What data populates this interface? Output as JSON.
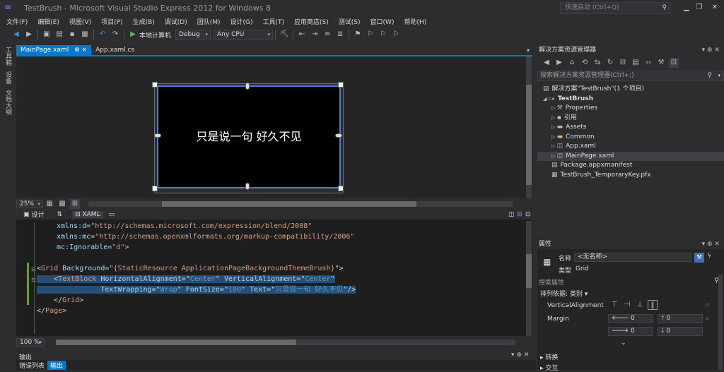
{
  "window": {
    "title": "TestBrush - Microsoft Visual Studio Express 2012 for Windows 8",
    "quick_launch": "快速启动 (Ctrl+Q)"
  },
  "menu": [
    "文件(F)",
    "编辑(E)",
    "视图(V)",
    "项目(P)",
    "生成(B)",
    "调试(D)",
    "团队(M)",
    "设计(G)",
    "工具(T)",
    "应用商店(S)",
    "测试(S)",
    "窗口(W)",
    "帮助(H)"
  ],
  "toolbar": {
    "run_target": "本地计算机",
    "config": "Debug",
    "platform": "Any CPU"
  },
  "left_tabs": [
    "工具箱",
    "设备",
    "文档大纲"
  ],
  "doc_tabs": [
    {
      "label": "MainPage.xaml",
      "pin": "⊕ ×"
    },
    {
      "label": "App.xaml.cs"
    }
  ],
  "designer": {
    "text": "只是说一句 好久不见",
    "zoom": "25%"
  },
  "split": {
    "design_label": "设计",
    "swap": "⇅",
    "xaml_label": "XAML"
  },
  "code_lines": [
    {
      "parts": [
        [
          "c-b",
          "xmlns:d"
        ],
        [
          "c-a",
          "="
        ],
        [
          "c-s",
          "\"http://schemas.microsoft.com/expression/blend/2008\""
        ]
      ]
    },
    {
      "parts": [
        [
          "c-b",
          "xmlns:mc"
        ],
        [
          "c-a",
          "="
        ],
        [
          "c-s",
          "\"http://schemas.openxmlformats.org/markup-compatibility/2006\""
        ]
      ]
    },
    {
      "parts": [
        [
          "c-b",
          "mc:Ignorable"
        ],
        [
          "c-a",
          "="
        ],
        [
          "c-s",
          "\"d\""
        ],
        [
          "c-a",
          ">"
        ]
      ]
    },
    {
      "parts": []
    },
    {
      "parts": [
        [
          "c-a",
          "<"
        ],
        [
          "c-s",
          "Grid"
        ],
        [
          "c-a",
          " "
        ],
        [
          "c-b",
          "Background"
        ],
        [
          "c-a",
          "=\""
        ],
        [
          "c-s",
          "{StaticResource ApplicationPageBackgroundThemeBrush}"
        ],
        [
          "c-a",
          "\">"
        ]
      ]
    },
    {
      "parts": [
        [
          "c-a",
          "    <"
        ],
        [
          "c-s",
          "TextBlock"
        ],
        [
          "c-a",
          " "
        ],
        [
          "c-b",
          "HorizontalAlignment"
        ],
        [
          "c-a",
          "=\""
        ],
        [
          "c-t",
          "Center"
        ],
        [
          "c-a",
          "\" "
        ],
        [
          "c-b",
          "VerticalAlignment"
        ],
        [
          "c-a",
          "=\""
        ],
        [
          "c-t",
          "Center"
        ],
        [
          "c-a",
          "\""
        ]
      ]
    },
    {
      "parts": [
        [
          "c-a",
          "               "
        ],
        [
          "c-b",
          "TextWrapping"
        ],
        [
          "c-a",
          "=\""
        ],
        [
          "c-t",
          "Wrap"
        ],
        [
          "c-a",
          "\" "
        ],
        [
          "c-b",
          "FontSize"
        ],
        [
          "c-a",
          "=\""
        ],
        [
          "c-t",
          "100"
        ],
        [
          "c-a",
          "\" "
        ],
        [
          "c-b",
          "Text"
        ],
        [
          "c-a",
          "=\""
        ],
        [
          "c-t",
          "只是说一句 好久不见"
        ],
        [
          "c-a",
          "\"/>"
        ]
      ]
    },
    {
      "parts": [
        [
          "c-a",
          "    </"
        ],
        [
          "c-s",
          "Grid"
        ],
        [
          "c-a",
          ">"
        ]
      ]
    },
    {
      "parts": [
        [
          "c-a",
          "</"
        ],
        [
          "c-s",
          "Page"
        ],
        [
          "c-a",
          ">"
        ]
      ]
    }
  ],
  "editor": {
    "zoom": "100 %"
  },
  "output": {
    "title": "输出",
    "tabs": [
      "错误列表",
      "输出"
    ]
  },
  "solution": {
    "title": "解决方案资源管理器",
    "search_placeholder": "搜索解决方案资源管理器(Ctrl+;)",
    "items": [
      {
        "label": "解决方案\"TestBrush\"(1 个项目)",
        "icon": "solution-icon"
      },
      {
        "label": "TestBrush",
        "icon": "csharp-project-icon"
      },
      {
        "label": "Properties",
        "icon": "wrench-icon"
      },
      {
        "label": "引用",
        "icon": "references-icon"
      },
      {
        "label": "Assets",
        "icon": "folder-icon"
      },
      {
        "label": "Common",
        "icon": "folder-icon"
      },
      {
        "label": "App.xaml",
        "icon": "xaml-file-icon"
      },
      {
        "label": "MainPage.xaml",
        "icon": "xaml-file-icon"
      },
      {
        "label": "Package.appxmanifest",
        "icon": "manifest-icon"
      },
      {
        "label": "TestBrush_TemporaryKey.pfx",
        "icon": "certificate-icon"
      }
    ]
  },
  "properties": {
    "title": "属性",
    "name_label": "名称",
    "name_value": "<无名称>",
    "type_label": "类型",
    "type_value": "Grid",
    "search_label": "搜索属性",
    "arrange_label": "排列依据: 类别 ▾",
    "valign_label": "VerticalAlignment",
    "margin_label": "Margin",
    "margin_values": [
      "0",
      "0",
      "0",
      "0"
    ],
    "sections": [
      "转换",
      "交互"
    ]
  }
}
